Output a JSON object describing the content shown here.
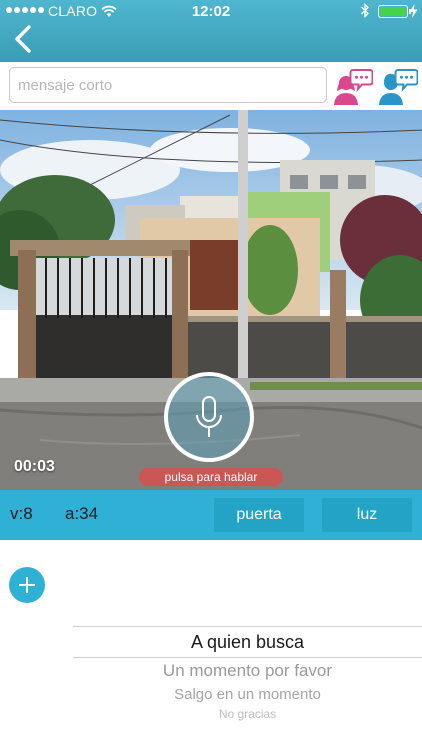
{
  "status_bar": {
    "carrier": "CLARO",
    "time": "12:02",
    "battery_level": 1.0
  },
  "nav": {
    "back_icon": "chevron-left-icon"
  },
  "message": {
    "placeholder": "mensaje corto",
    "value": ""
  },
  "contacts": [
    {
      "icon": "woman-chat-icon",
      "color": "#d9488f"
    },
    {
      "icon": "man-chat-icon",
      "color": "#2a95c7"
    }
  ],
  "camera": {
    "elapsed": "00:03",
    "talk_hint": "pulsa para hablar",
    "mic_icon": "microphone-icon"
  },
  "controls": {
    "video_stat": "v:8",
    "audio_stat": "a:34",
    "door_button": "puerta",
    "light_button": "luz"
  },
  "quick_replies": {
    "add_icon": "plus-icon",
    "selected": "A quien busca",
    "options": [
      "Un momento por favor",
      "Salgo en un momento",
      "No gracias"
    ]
  },
  "colors": {
    "accent": "#2fb1d6",
    "header": "#4fb6cf",
    "talk_label": "#d75050"
  }
}
